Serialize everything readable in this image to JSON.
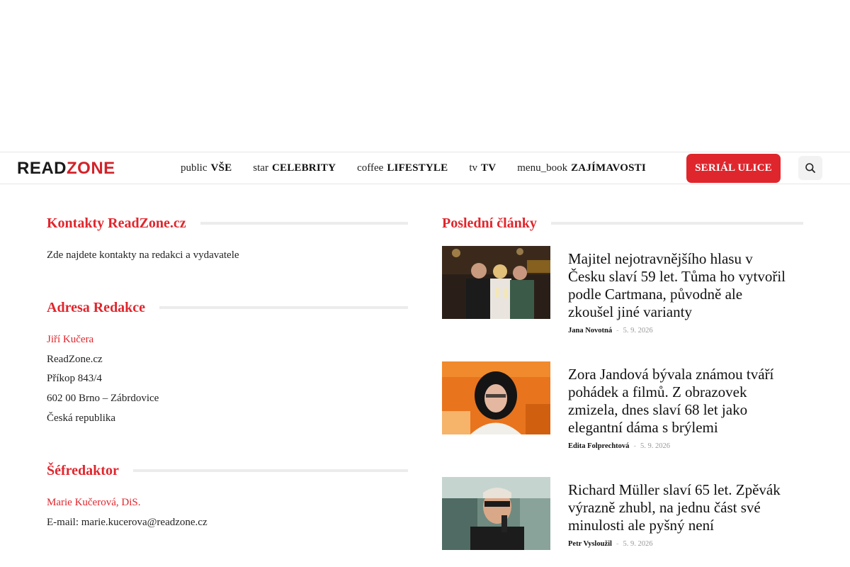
{
  "site": {
    "logo_read": "READ",
    "logo_zone": "ZONE"
  },
  "nav": {
    "items": [
      {
        "icon": "public",
        "label": "VŠE"
      },
      {
        "icon": "star",
        "label": "CELEBRITY"
      },
      {
        "icon": "coffee",
        "label": "LIFESTYLE"
      },
      {
        "icon": "tv",
        "label": "TV"
      },
      {
        "icon": "menu_book",
        "label": "ZAJÍMAVOSTI"
      }
    ],
    "cta_label": "SERIÁL ULICE",
    "search_icon": "search-icon"
  },
  "contacts": {
    "title": "Kontakty ReadZone.cz",
    "intro": "Zde najdete kontakty na redakci a vydavatele",
    "address_title": "Adresa Redakce",
    "address": {
      "name": "Jiří Kučera",
      "lines": [
        "ReadZone.cz",
        "Příkop 843/4",
        "602 00 Brno – Zábrdovice",
        "Česká republika"
      ]
    },
    "editor_title": "Šéfredaktor",
    "editor": {
      "name": "Marie Kučerová, DiS.",
      "email_label": "E-mail:",
      "email": "marie.kucerova@readzone.cz"
    }
  },
  "latest": {
    "title": "Poslední články",
    "articles": [
      {
        "title": "Majitel nejotravnějšího hlasu v Česku slaví 59 let. Tůma ho vytvořil podle Cartmana, původně ale zkoušel jiné varianty",
        "author": "Jana Novotná",
        "date": "5. 9. 2026"
      },
      {
        "title": "Zora Jandová bývala známou tváří pohádek a filmů. Z obrazovek zmizela, dnes slaví 68 let jako elegantní dáma s brýlemi",
        "author": "Edita Folprechtová",
        "date": "5. 9. 2026"
      },
      {
        "title": "Richard Müller slaví 65 let. Zpěvák výrazně zhubl, na jednu část své minulosti ale pyšný není",
        "author": "Petr Vysloužil",
        "date": "5. 9. 2026"
      }
    ]
  },
  "colors": {
    "accent": "#e0262d",
    "divider": "#ececec"
  }
}
